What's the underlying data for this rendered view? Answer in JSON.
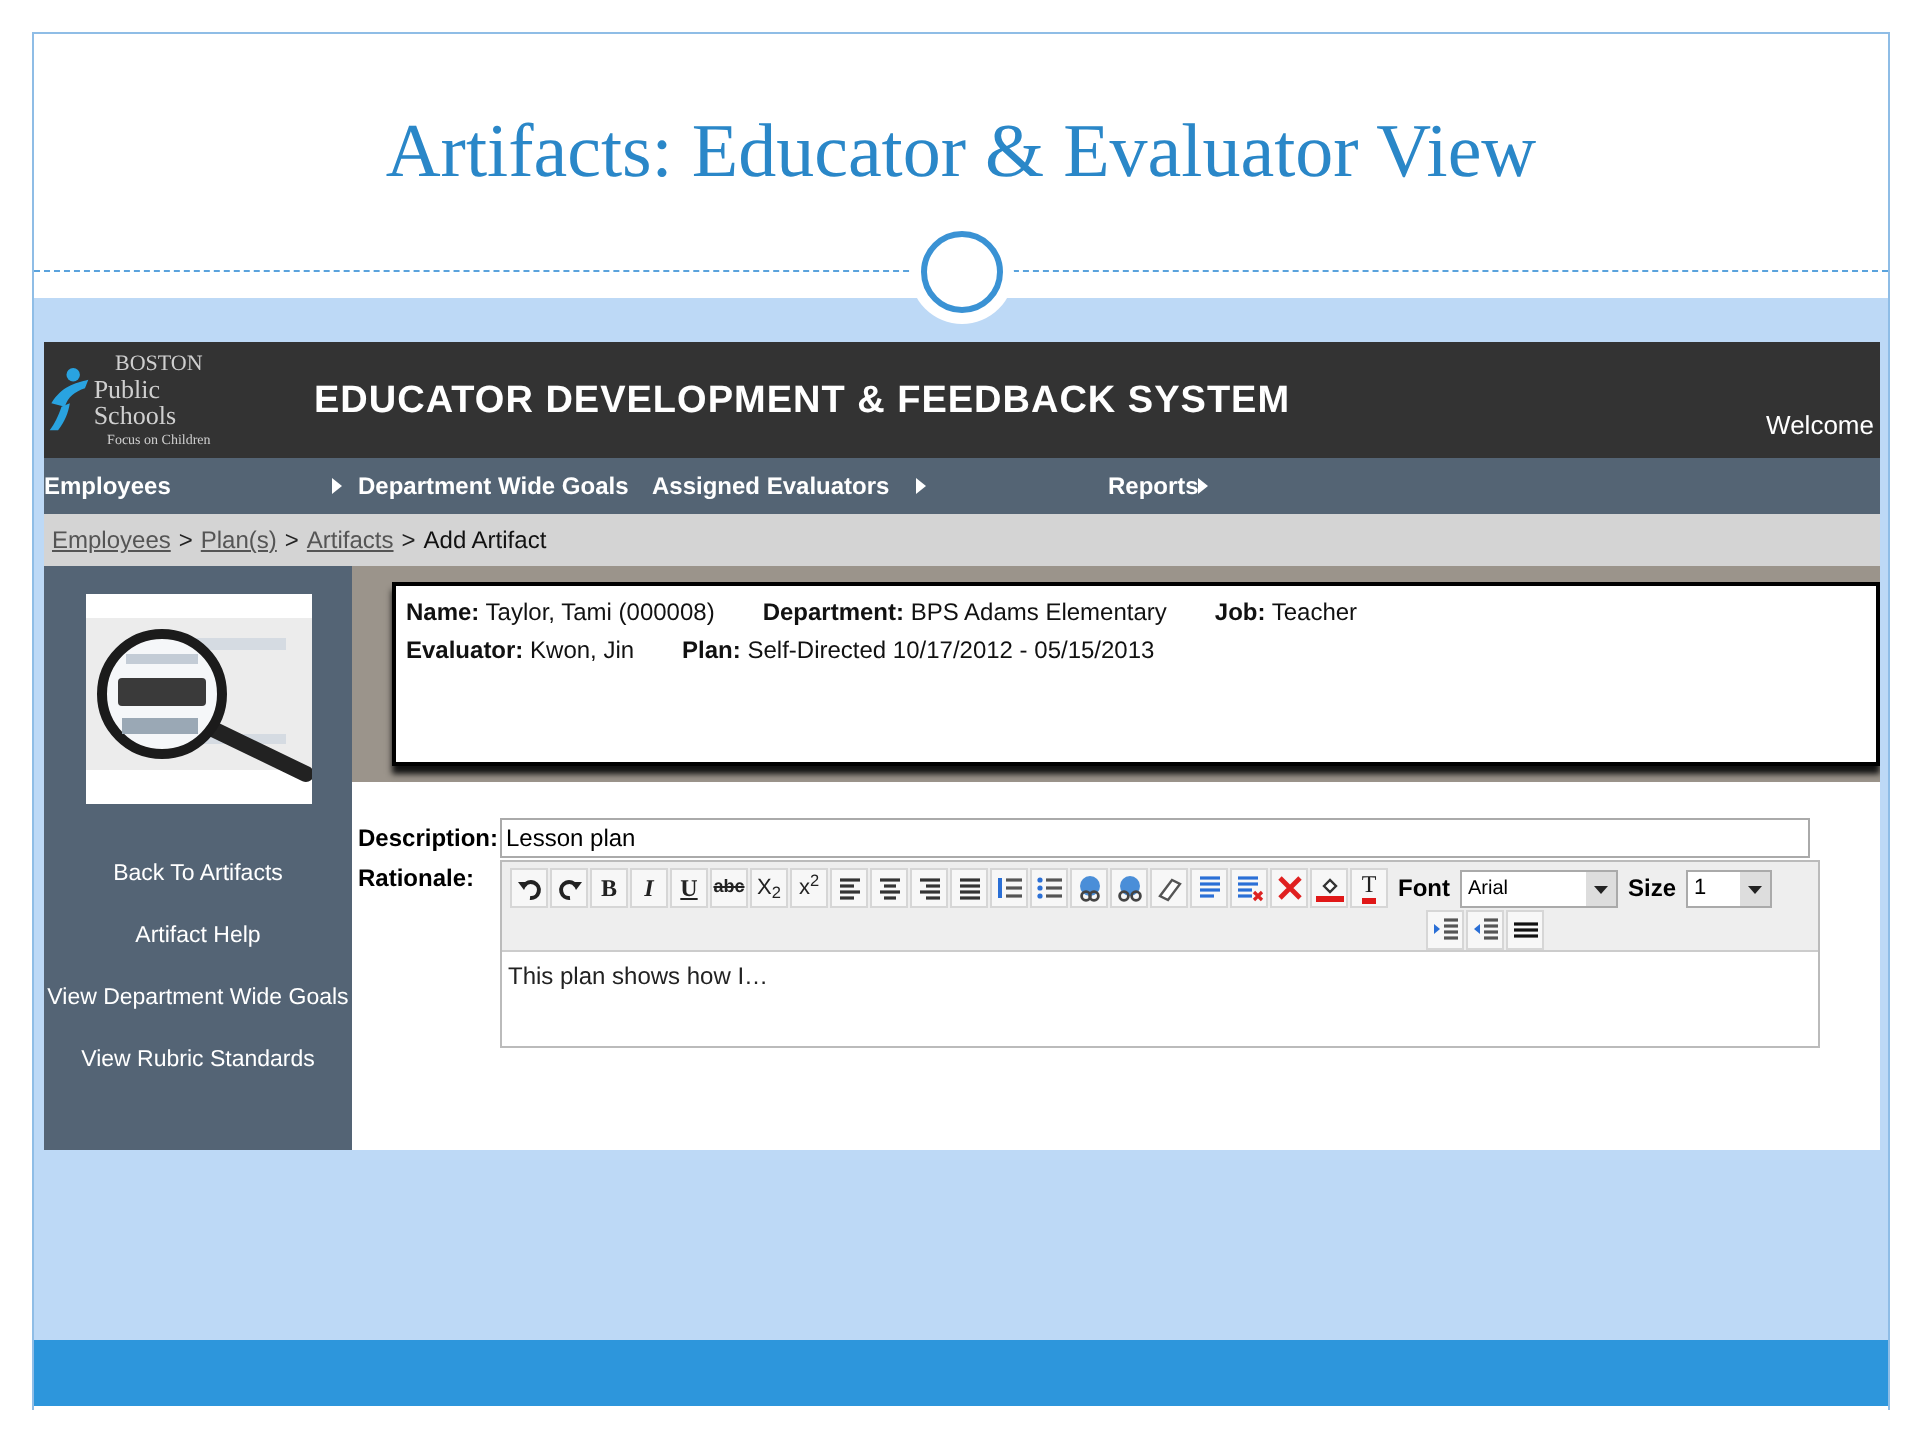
{
  "slide": {
    "title": "Artifacts: Educator & Evaluator View"
  },
  "app": {
    "logo": {
      "line1": "BOSTON",
      "line2": "Public Schools",
      "tagline": "Focus on Children"
    },
    "system_title": "EDUCATOR DEVELOPMENT & FEEDBACK SYSTEM",
    "welcome": "Welcome",
    "menu": [
      {
        "label": "Employees",
        "submenu": true
      },
      {
        "label": "Department Wide Goals",
        "submenu": false
      },
      {
        "label": "Assigned Evaluators",
        "submenu": true
      },
      {
        "label": "Reports",
        "submenu": true
      }
    ],
    "breadcrumb": [
      {
        "label": "Employees",
        "link": true
      },
      {
        "label": "Plan(s)",
        "link": true
      },
      {
        "label": "Artifacts",
        "link": true
      },
      {
        "label": "Add Artifact",
        "link": false
      }
    ],
    "breadcrumb_separator": ">",
    "sidebar": {
      "links": [
        "Back To Artifacts",
        "Artifact Help",
        "View Department Wide Goals",
        "View Rubric Standards"
      ]
    },
    "info": [
      [
        "**Name:** Taylor, Tami (000008)",
        "**Department:** BPS Adams Elementary",
        "**Job:** Teacher"
      ],
      [
        "**Evaluator:** Kwon, Jin",
        "**Plan:** Self-Directed 10/17/2012 - 05/15/2013"
      ]
    ],
    "description": {
      "label": "Description:",
      "value": "Lesson plan"
    },
    "rationale": {
      "label": "Rationale:",
      "toolbar": [
        {
          "kind": "undo"
        },
        {
          "kind": "redo"
        },
        {
          "kind": "bold",
          "label": "B"
        },
        {
          "kind": "italic",
          "label": "I"
        },
        {
          "kind": "underline",
          "label": "U"
        },
        {
          "kind": "strike",
          "label": "abc"
        },
        {
          "kind": "script",
          "label": "X$_{2}$"
        },
        {
          "kind": "script",
          "label": "x$^{2}$"
        },
        {
          "kind": "align-left"
        },
        {
          "kind": "align-center"
        },
        {
          "kind": "align-right"
        },
        {
          "kind": "justify"
        },
        {
          "kind": "ordered-list"
        },
        {
          "kind": "bullet-list"
        },
        {
          "kind": "link"
        },
        {
          "kind": "unlink"
        },
        {
          "kind": "eraser"
        },
        {
          "kind": "paragraph"
        },
        {
          "kind": "clear-format"
        },
        {
          "kind": "delete"
        },
        {
          "kind": "fill-color"
        },
        {
          "kind": "text-color",
          "label": "T"
        }
      ],
      "font": {
        "label": "Font",
        "value": "Arial"
      },
      "size": {
        "label": "Size",
        "value": "1"
      },
      "toolbar_row2": [
        {
          "kind": "indent"
        },
        {
          "kind": "outdent"
        },
        {
          "kind": "rule"
        }
      ],
      "text": "This plan shows how I…"
    }
  }
}
